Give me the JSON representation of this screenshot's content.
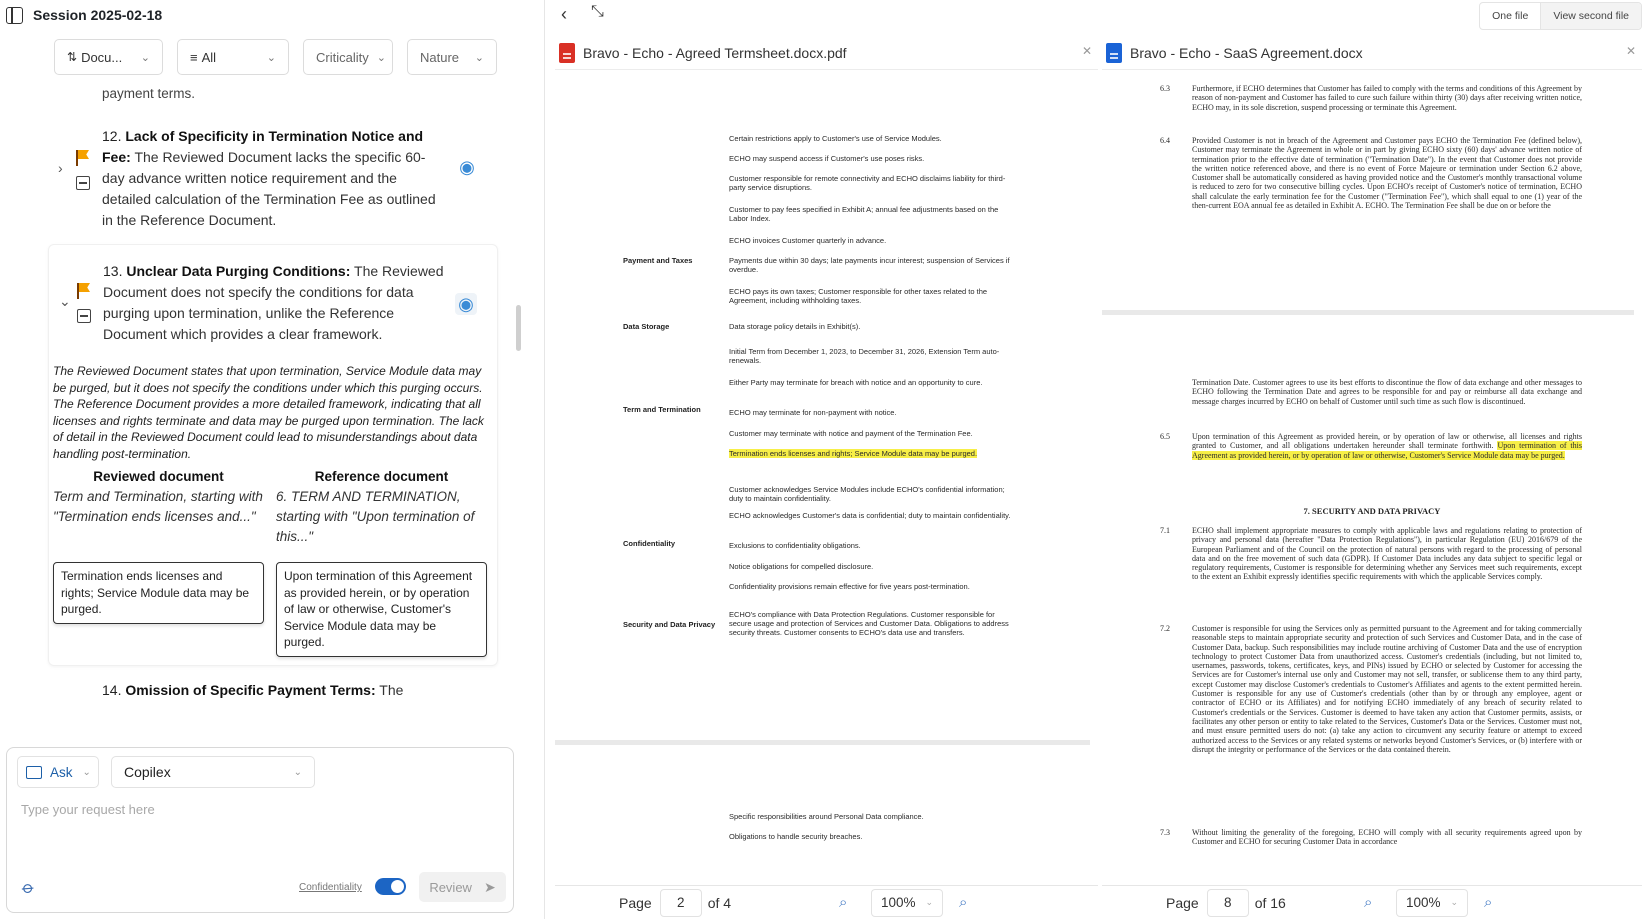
{
  "session": {
    "title": "Session 2025-02-18"
  },
  "filters": [
    {
      "label": "Docu...",
      "icon": "sort-icon"
    },
    {
      "label": "All",
      "icon": "filter-icon"
    },
    {
      "label": "Criticality"
    },
    {
      "label": "Nature"
    }
  ],
  "issues": {
    "prev_tail": "payment terms.",
    "i12": {
      "number": "12.",
      "title": "Lack of Specificity in Termination Notice and Fee:",
      "body": "The Reviewed Document lacks the specific 60-day advance written notice requirement and the detailed calculation of the Termination Fee as outlined in the Reference Document."
    },
    "i13": {
      "number": "13.",
      "title": "Unclear Data Purging Conditions:",
      "body": "The Reviewed Document does not specify the conditions for data purging upon termination, unlike the Reference Document which provides a clear framework.",
      "detail": "The Reviewed Document states that upon termination, Service Module data may be purged, but it does not specify the conditions under which this purging occurs. The Reference Document provides a more detailed framework, indicating that all licenses and rights terminate and data may be purged upon termination. The lack of detail in the Reviewed Document could lead to misunderstandings about data handling post-termination.",
      "reviewed_header": "Reviewed document",
      "reviewed_sub": "Term and Termination, starting with \"Termination ends licenses and...\"",
      "reviewed_quote": "Termination ends licenses and rights; Service Module data may be purged.",
      "reference_header": "Reference document",
      "reference_sub": "6. TERM AND TERMINATION, starting with \"Upon termination of this...\"",
      "reference_quote": "Upon termination of this Agreement as provided herein, or by operation of law or otherwise, Customer's Service Module data may be purged."
    },
    "i14": {
      "number": "14.",
      "title": "Omission of Specific Payment Terms:",
      "body": "The"
    }
  },
  "composer": {
    "mode": "Ask",
    "model": "Copilex",
    "placeholder": "Type your request here",
    "confidentiality_label": "Confidentiality",
    "confidentiality_on": true,
    "review_label": "Review"
  },
  "toolbar": {
    "one_file": "One file",
    "view_second": "View second file"
  },
  "doc1": {
    "name": "Bravo - Echo - Agreed Termsheet.docx.pdf",
    "page": "2",
    "of": "of 4",
    "page_label": "Page",
    "zoom": "100%",
    "sections": [
      {
        "label": "",
        "lines": [
          "Certain restrictions apply to Customer's use of Service Modules.",
          "ECHO may suspend access if Customer's use poses risks.",
          "Customer responsible for remote connectivity and ECHO disclaims liability for third-party service disruptions.",
          "Customer to pay fees specified in Exhibit A; annual fee adjustments based on the Labor Index.",
          "ECHO invoices Customer quarterly in advance."
        ]
      },
      {
        "label": "Payment and Taxes",
        "lines": [
          "Payments due within 30 days; late payments incur interest; suspension of Services if overdue.",
          "ECHO pays its own taxes; Customer responsible for other taxes related to the Agreement, including withholding taxes."
        ]
      },
      {
        "label": "Data Storage",
        "lines": [
          "Data storage policy details in Exhibit(s).",
          "Initial Term from December 1, 2023, to December 31, 2026, Extension Term auto-renewals."
        ]
      },
      {
        "label": "Term and Termination",
        "lines": [
          "Either Party may terminate for breach with notice and an opportunity to cure.",
          "ECHO may terminate for non-payment with notice.",
          "Customer may terminate with notice and payment of the Termination Fee.",
          "Termination ends licenses and rights; Service Module data may be purged."
        ]
      },
      {
        "label": "Confidentiality",
        "lines": [
          "Customer acknowledges Service Modules include ECHO's confidential information; duty to maintain confidentiality.",
          "ECHO acknowledges Customer's data is confidential; duty to maintain confidentiality.",
          "Exclusions to confidentiality obligations.",
          "Notice obligations for compelled disclosure.",
          "Confidentiality provisions remain effective for five years post-termination."
        ]
      },
      {
        "label": "Security and Data Privacy",
        "lines": [
          "ECHO's compliance with Data Protection Regulations. Customer responsible for secure usage and protection of Services and Customer Data. Obligations to address security threats. Customer consents to ECHO's data use and transfers."
        ]
      }
    ],
    "next_page_lines": [
      "Specific responsibilities around Personal Data compliance.",
      "Obligations to handle security breaches."
    ]
  },
  "doc2": {
    "name": "Bravo - Echo - SaaS Agreement.docx",
    "page": "8",
    "of": "of 16",
    "page_label": "Page",
    "zoom": "100%",
    "p63_num": "6.3",
    "p63": "Furthermore, if ECHO determines that Customer has failed to comply with the terms and conditions of this Agreement by reason of non-payment and Customer has failed to cure such failure within thirty (30) days after receiving written notice, ECHO may, in its sole discretion, suspend processing or terminate this Agreement.",
    "p64_num": "6.4",
    "p64": "Provided Customer is not in breach of the Agreement and Customer pays ECHO the Termination Fee (defined below), Customer may terminate the Agreement in whole or in part by giving ECHO sixty (60) days' advance written notice of termination prior to the effective date of termination (\"Termination Date\"). In the event that Customer does not provide the written notice referenced above, and there is no event of Force Majeure or termination under Section 6.2 above, Customer shall be automatically considered as having provided notice and the Customer's monthly transactional volume is reduced to zero for two consecutive billing cycles. Upon ECHO's receipt of Customer's notice of termination, ECHO shall calculate the early termination fee for the Customer (\"Termination Fee\"), which shall equal to one (1) year of the then-current EOA annual fee as detailed in Exhibit A. ECHO. The Termination Fee shall be due on or before the",
    "p64b": "Termination Date. Customer agrees to use its best efforts to discontinue the flow of data exchange and other messages to ECHO following the Termination Date and agrees to be responsible for and pay or reimburse all data exchange and message charges incurred by ECHO on behalf of Customer until such time as such flow is discontinued.",
    "p65_num": "6.5",
    "p65_pre": "Upon termination of this Agreement as provided herein, or by operation of law or otherwise, all licenses and rights granted to Customer, and all obligations undertaken hereunder shall terminate forthwith.",
    "p65_hl": "Upon termination of this Agreement as provided herein, or by operation of law or otherwise, Customer's Service Module data may be purged.",
    "h7": "7.        SECURITY AND DATA PRIVACY",
    "p71_num": "7.1",
    "p71": "ECHO shall implement appropriate measures to comply with applicable laws and regulations relating to protection of privacy and personal data (hereafter \"Data Protection Regulations\"), in particular Regulation (EU) 2016/679 of the European Parliament and of the Council on the protection of natural persons with regard to the processing of personal data and on the free movement of such data (GDPR). If Customer Data includes any data subject to specific legal or regulatory requirements, Customer is responsible for determining whether any Services meet such requirements, except to the extent an Exhibit expressly identifies specific requirements with which the applicable Services comply.",
    "p72_num": "7.2",
    "p72": "Customer is responsible for using the Services only as permitted pursuant to the Agreement and for taking commercially reasonable steps to maintain appropriate security and protection of such Services and Customer Data, and in the case of Customer Data, backup. Such responsibilities may include routine archiving of Customer Data and the use of encryption technology to protect Customer Data from unauthorized access. Customer's credentials (including, but not limited to, usernames, passwords, tokens, certificates, keys, and PINs) issued by ECHO or selected by Customer for accessing the Services are for Customer's internal use only and Customer may not sell, transfer, or sublicense them to any third party, except Customer may disclose Customer's credentials to Customer's Affiliates and agents to the extent permitted herein. Customer is responsible for any use of Customer's credentials (other than by or through any employee, agent or contractor of ECHO or its Affiliates) and for notifying ECHO immediately of any breach of security related to Customer's credentials or the Services. Customer is deemed to have taken any action that Customer permits, assists, or facilitates any other person or entity to take related to the Services, Customer's Data or the Services. Customer must not, and must ensure permitted users do not: (a) take any action to circumvent any security feature or attempt to exceed authorized access to the Services or any related systems or networks beyond Customer's Services, or (b) interfere with or disrupt the integrity or performance of the Services or the data contained therein.",
    "p73_num": "7.3",
    "p73": "Without limiting the generality of the foregoing, ECHO will comply with all security requirements agreed upon by Customer and ECHO for securing Customer Data in accordance"
  }
}
